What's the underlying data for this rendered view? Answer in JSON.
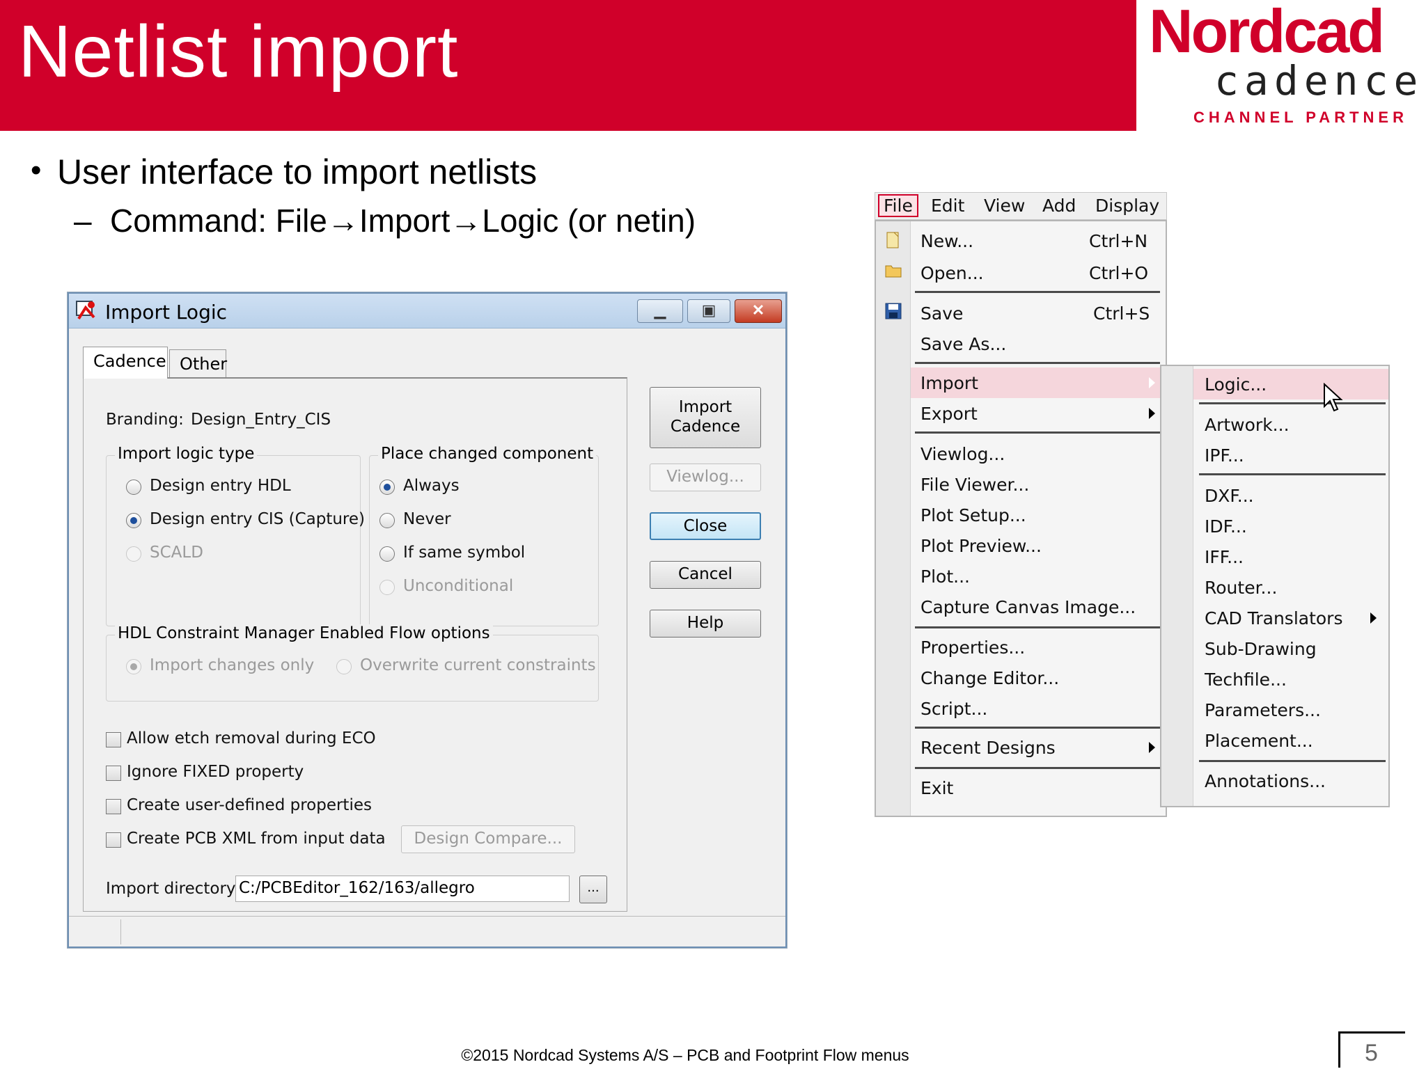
{
  "slide": {
    "title": "Netlist import",
    "logo": {
      "brand": "Nordcad",
      "partner_brand": "cadence",
      "tagline": "CHANNEL PARTNER"
    },
    "bullet": "User interface to import netlists",
    "sub_bullet": "Command: File→Import→Logic (or netin)",
    "footer": "©2015 Nordcad Systems A/S – PCB and Footprint Flow menus",
    "page_number": "5"
  },
  "dialog": {
    "title": "Import Logic",
    "tabs": [
      "Cadence",
      "Other"
    ],
    "branding_label": "Branding:",
    "branding_value": "Design_Entry_CIS",
    "logic_type": {
      "title": "Import logic type",
      "options": [
        "Design entry HDL",
        "Design entry CIS (Capture)",
        "SCALD"
      ],
      "selected": "Design entry CIS (Capture)"
    },
    "place_changed": {
      "title": "Place changed component",
      "options": [
        "Always",
        "Never",
        "If same symbol",
        "Unconditional"
      ],
      "selected": "Always"
    },
    "hdl_options": {
      "title": "HDL Constraint Manager Enabled Flow options",
      "options": [
        "Import changes only",
        "Overwrite current constraints"
      ]
    },
    "checkboxes": [
      "Allow etch removal during ECO",
      "Ignore FIXED property",
      "Create user-defined properties",
      "Create PCB XML from input data"
    ],
    "design_compare": "Design Compare...",
    "import_dir_label": "Import directory:",
    "import_dir_value": "C:/PCBEditor_162/163/allegro",
    "browse": "...",
    "buttons": {
      "import_line1": "Import",
      "import_line2": "Cadence",
      "viewlog": "Viewlog...",
      "close": "Close",
      "cancel": "Cancel",
      "help": "Help"
    }
  },
  "menubar": [
    "File",
    "Edit",
    "View",
    "Add",
    "Display"
  ],
  "file_menu": {
    "new": "New...",
    "new_sc": "Ctrl+N",
    "open": "Open...",
    "open_sc": "Ctrl+O",
    "save": "Save",
    "save_sc": "Ctrl+S",
    "save_as": "Save As...",
    "import": "Import",
    "export": "Export",
    "viewlog": "Viewlog...",
    "file_viewer": "File Viewer...",
    "plot_setup": "Plot Setup...",
    "plot_preview": "Plot Preview...",
    "plot": "Plot...",
    "capture_canvas": "Capture Canvas Image...",
    "properties": "Properties...",
    "change_editor": "Change Editor...",
    "script": "Script...",
    "recent": "Recent Designs",
    "exit": "Exit"
  },
  "import_submenu": {
    "logic": "Logic...",
    "artwork": "Artwork...",
    "ipf": "IPF...",
    "dxf": "DXF...",
    "idf": "IDF...",
    "iff": "IFF...",
    "router": "Router...",
    "cad_translators": "CAD Translators",
    "sub_drawing": "Sub-Drawing",
    "techfile": "Techfile...",
    "parameters": "Parameters...",
    "placement": "Placement...",
    "annotations": "Annotations..."
  },
  "colors": {
    "accent": "#d0002a",
    "highlight": "#f5d6dc",
    "titlebar": "#b9d1ea"
  }
}
